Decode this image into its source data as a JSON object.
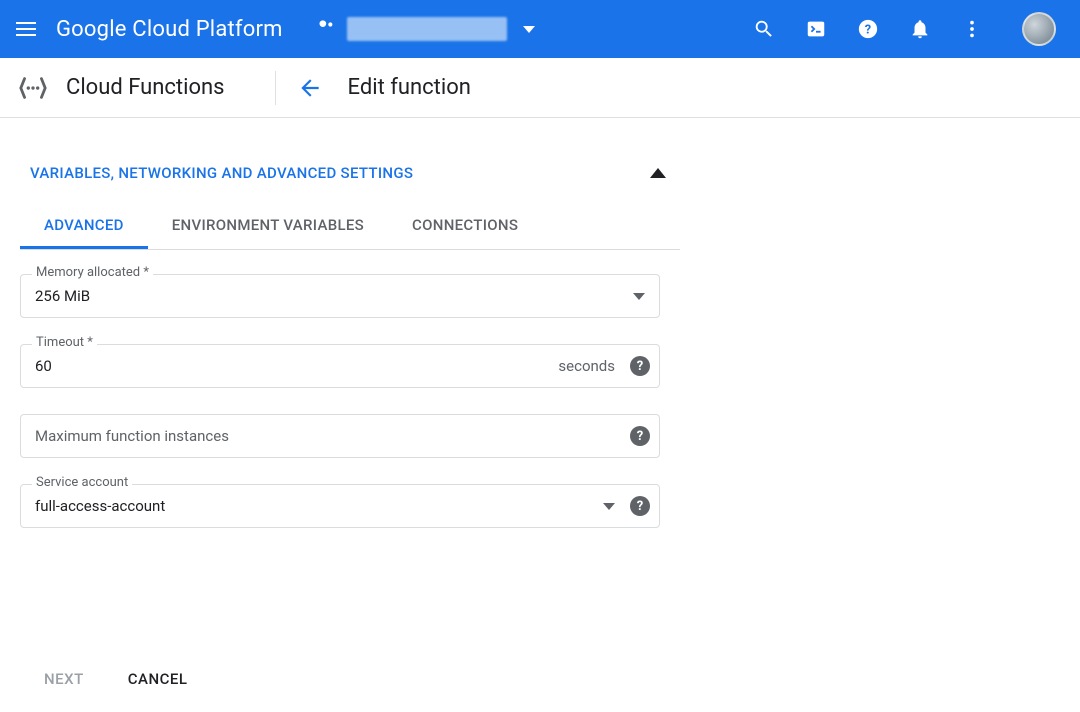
{
  "topbar": {
    "brand": "Google Cloud Platform"
  },
  "secondbar": {
    "service_name": "Cloud Functions",
    "page_title": "Edit function"
  },
  "accordion": {
    "title": "VARIABLES, NETWORKING AND ADVANCED SETTINGS"
  },
  "tabs": {
    "items": [
      {
        "label": "ADVANCED",
        "active": true
      },
      {
        "label": "ENVIRONMENT VARIABLES",
        "active": false
      },
      {
        "label": "CONNECTIONS",
        "active": false
      }
    ]
  },
  "form": {
    "memory": {
      "label": "Memory allocated *",
      "value": "256 MiB"
    },
    "timeout": {
      "label": "Timeout *",
      "value": "60",
      "suffix": "seconds"
    },
    "max_instances": {
      "label": "Maximum function instances",
      "value": ""
    },
    "service_account": {
      "label": "Service account",
      "value": "full-access-account"
    }
  },
  "footer": {
    "next": "NEXT",
    "cancel": "CANCEL"
  }
}
